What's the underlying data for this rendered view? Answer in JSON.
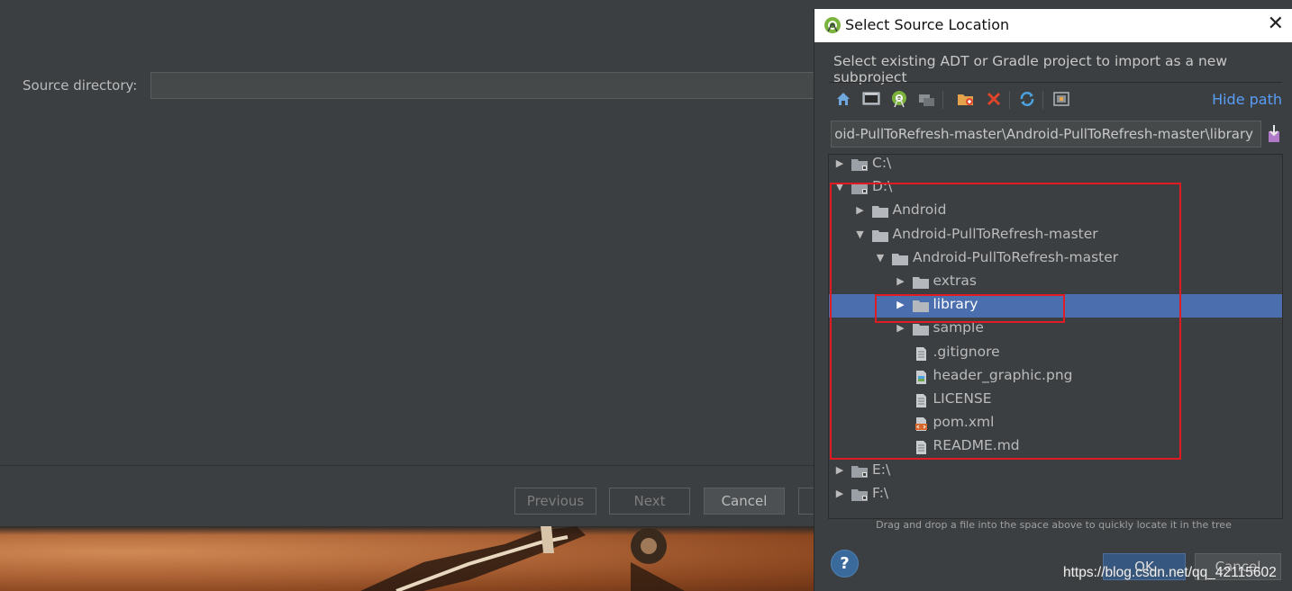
{
  "wizard": {
    "source_label": "Source directory:",
    "source_value": "",
    "buttons": {
      "previous": "Previous",
      "next": "Next",
      "cancel": "Cancel"
    }
  },
  "dialog": {
    "title": "Select Source Location",
    "description": "Select existing ADT or Gradle project to import as a new subproject",
    "hide_path": "Hide path",
    "path": "oid-PullToRefresh-master\\Android-PullToRefresh-master\\library",
    "toolbar_icons": [
      "home-icon",
      "desktop-icon",
      "android-project-icon",
      "module-icon",
      "new-folder-icon",
      "delete-icon",
      "refresh-icon",
      "show-hidden-icon"
    ],
    "tree": [
      {
        "label": "C:\\",
        "expanded": false,
        "type": "drive"
      },
      {
        "label": "D:\\",
        "expanded": true,
        "type": "drive"
      },
      {
        "label": "Android",
        "expanded": false,
        "type": "folder"
      },
      {
        "label": "Android-PullToRefresh-master",
        "expanded": true,
        "type": "folder"
      },
      {
        "label": "Android-PullToRefresh-master",
        "expanded": true,
        "type": "folder"
      },
      {
        "label": "extras",
        "expanded": false,
        "type": "folder"
      },
      {
        "label": "library",
        "expanded": false,
        "type": "folder",
        "selected": true
      },
      {
        "label": "sample",
        "expanded": false,
        "type": "folder"
      },
      {
        "label": ".gitignore",
        "type": "file"
      },
      {
        "label": "header_graphic.png",
        "type": "image-file"
      },
      {
        "label": "LICENSE",
        "type": "file"
      },
      {
        "label": "pom.xml",
        "type": "xml-file"
      },
      {
        "label": "README.md",
        "type": "file"
      },
      {
        "label": "E:\\",
        "expanded": false,
        "type": "drive"
      },
      {
        "label": "F:\\",
        "expanded": false,
        "type": "drive"
      }
    ],
    "drag_hint": "Drag and drop a file into the space above to quickly locate it in the tree",
    "help_label": "?",
    "ok_label": "OK",
    "cancel_label": "Cancel"
  },
  "watermark": "https://blog.csdn.net/qq_42115602",
  "colors": {
    "selection": "#4b6eaf",
    "highlight_box": "#e01b24",
    "link": "#589df6"
  }
}
